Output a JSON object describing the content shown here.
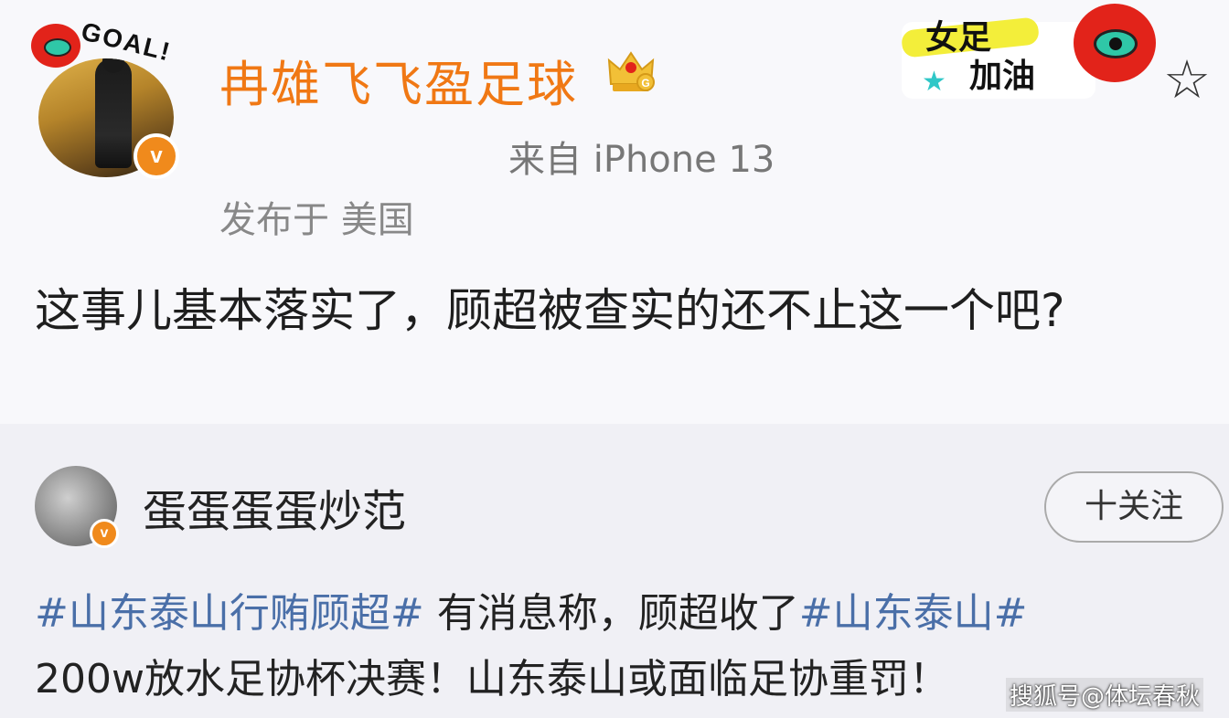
{
  "post": {
    "username": "冉雄飞飞盈足球",
    "source": "来自 iPhone 13",
    "location": "发布于 美国",
    "text": "这事儿基本落实了，顾超被查实的还不止这一个吧?",
    "avatar_badge_text": "GOAL!",
    "verify_icon": "v"
  },
  "sticker": {
    "line1": "女足",
    "line2": "加油"
  },
  "repost": {
    "username": "蛋蛋蛋蛋炒范",
    "follow_label": "十关注",
    "hashtag1": "#山东泰山行贿顾超#",
    "text1": " 有消息称，顾超收了",
    "hashtag2": "#山东泰山#",
    "text2": "200w放水足协杯决赛！山东泰山或面临足协重罚！"
  },
  "watermark": "搜狐号@体坛春秋",
  "colors": {
    "username": "#f07814",
    "hashtag": "#4a6fa8",
    "verify": "#f08a1c"
  }
}
